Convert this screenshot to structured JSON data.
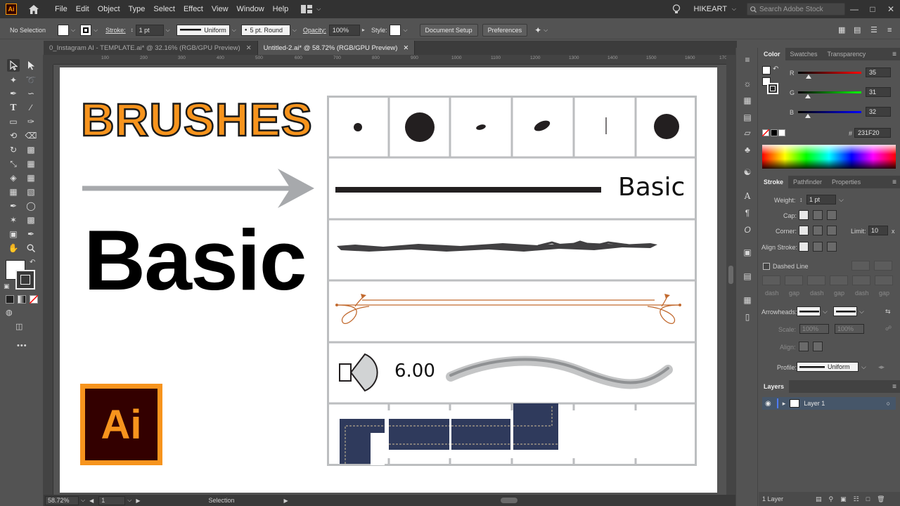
{
  "app": {
    "logo_text": "Ai",
    "menu": [
      "File",
      "Edit",
      "Object",
      "Type",
      "Select",
      "Effect",
      "View",
      "Window",
      "Help"
    ],
    "user": "HIKEART",
    "search_placeholder": "Search Adobe Stock"
  },
  "control_bar": {
    "selection": "No Selection",
    "stroke_label": "Stroke:",
    "stroke_weight": "1 pt",
    "profile": "Uniform",
    "brush": "5 pt. Round",
    "opacity_label": "Opacity:",
    "opacity": "100%",
    "style_label": "Style:",
    "doc_setup": "Document Setup",
    "preferences": "Preferences"
  },
  "tabs": [
    {
      "label": "0_Instagram AI - TEMPLATE.ai* @ 32.16% (RGB/GPU Preview)",
      "active": false
    },
    {
      "label": "Untitled-2.ai* @ 58.72% (RGB/GPU Preview)",
      "active": true
    }
  ],
  "ruler_marks": [
    "100",
    "200",
    "300",
    "400",
    "500",
    "600",
    "700",
    "800",
    "900",
    "1000",
    "1100",
    "1200",
    "1300",
    "1400",
    "1500",
    "1600",
    "1700"
  ],
  "artboard": {
    "title": "BRUSHES",
    "big_word": "Basic",
    "small_word": "Basic",
    "angle_value": "6.00",
    "logo_text": "Ai"
  },
  "status": {
    "zoom": "58.72%",
    "page": "1",
    "tool": "Selection"
  },
  "color_panel": {
    "tabs": [
      "Color",
      "Swatches",
      "Transparency"
    ],
    "r_label": "R",
    "g_label": "G",
    "b_label": "B",
    "r": "35",
    "g": "31",
    "b": "32",
    "hex_label": "#",
    "hex": "231F20"
  },
  "stroke_panel": {
    "tabs": [
      "Stroke",
      "Pathfinder",
      "Properties"
    ],
    "weight_label": "Weight:",
    "weight": "1 pt",
    "cap_label": "Cap:",
    "corner_label": "Corner:",
    "limit_label": "Limit:",
    "limit": "10",
    "limit_unit": "x",
    "align_label": "Align Stroke:",
    "dashed_label": "Dashed Line",
    "dash_labels": [
      "dash",
      "gap",
      "dash",
      "gap",
      "dash",
      "gap"
    ],
    "arrowheads_label": "Arrowheads:",
    "scale_label": "Scale:",
    "scale1": "100%",
    "scale2": "100%",
    "align2_label": "Align:",
    "profile_label": "Profile:",
    "profile": "Uniform"
  },
  "layers_panel": {
    "title": "Layers",
    "layer_name": "Layer 1",
    "footer": "1 Layer"
  },
  "colors": {
    "accent_orange": "#f7941d",
    "logo_bg": "#330000",
    "fill_color": "#231F20"
  }
}
